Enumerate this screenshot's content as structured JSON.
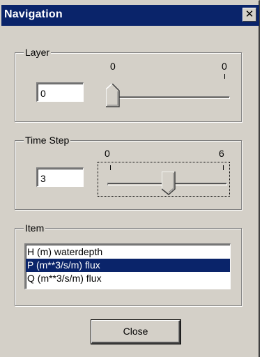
{
  "window": {
    "title": "Navigation",
    "close_glyph": "✕",
    "accent_color": "#0a246a",
    "face_color": "#d4d0c8"
  },
  "layer": {
    "label": "Layer",
    "value": "0",
    "min_label": "0",
    "max_label": "0",
    "min": 0,
    "max": 0,
    "position": 0
  },
  "time_step": {
    "label": "Time Step",
    "value": "3",
    "min_label": "0",
    "max_label": "6",
    "min": 0,
    "max": 6,
    "position": 3
  },
  "item": {
    "label": "Item",
    "items": [
      {
        "text": "H (m) waterdepth",
        "selected": false
      },
      {
        "text": "P (m**3/s/m) flux",
        "selected": true
      },
      {
        "text": "Q (m**3/s/m) flux",
        "selected": false
      }
    ]
  },
  "buttons": {
    "close_label": "Close"
  }
}
